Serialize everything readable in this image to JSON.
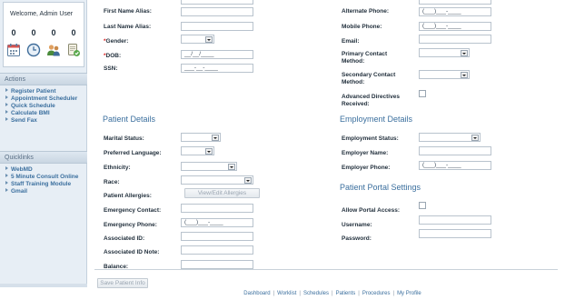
{
  "sidebar": {
    "welcome": "Welcome, Admin User",
    "counts": [
      "0",
      "0",
      "0",
      "0"
    ],
    "icons": [
      "calendar-icon",
      "clock-icon",
      "users-icon",
      "task-check-icon"
    ],
    "actions_title": "Actions",
    "actions": [
      "Register Patient",
      "Appointment Scheduler",
      "Quick Schedule",
      "Calculate BMI",
      "Send Fax"
    ],
    "quicklinks_title": "Quicklinks",
    "quicklinks": [
      "WebMD",
      "5 Minute Consult Online",
      "Staff Training Module",
      "Gmail"
    ]
  },
  "form_top_left": {
    "first_name_alias": "First Name Alias:",
    "last_name_alias": "Last Name Alias:",
    "gender": "Gender:",
    "dob": "DOB:",
    "dob_value": "__/__/____",
    "ssn": "SSN:",
    "ssn_value": "___-__-____",
    "required_mark": "*"
  },
  "form_top_right": {
    "alternate_phone": "Alternate Phone:",
    "alternate_phone_value": "(___)___-____",
    "mobile_phone": "Mobile Phone:",
    "mobile_phone_value": "(___)___-____",
    "email": "Email:",
    "primary_contact_1": "Primary Contact",
    "primary_contact_2": "Method:",
    "secondary_contact_1": "Secondary Contact",
    "secondary_contact_2": "Method:",
    "advanced_directives_1": "Advanced Directives",
    "advanced_directives_2": "Received:"
  },
  "patient_details": {
    "title": "Patient Details",
    "marital_status": "Marital Status:",
    "preferred_language": "Preferred Language:",
    "ethnicity": "Ethnicity:",
    "race": "Race:",
    "patient_allergies": "Patient Allergies:",
    "view_edit_allergies": "View/Edit Allergies",
    "emergency_contact": "Emergency Contact:",
    "emergency_phone": "Emergency Phone:",
    "emergency_phone_value": "(___)___-____",
    "associated_id": "Associated ID:",
    "associated_id_note": "Associated ID Note:",
    "balance": "Balance:"
  },
  "employment_details": {
    "title": "Employment Details",
    "employment_status": "Employment Status:",
    "employer_name": "Employer Name:",
    "employer_phone": "Employer Phone:",
    "employer_phone_value": "(___)___-____"
  },
  "patient_portal": {
    "title": "Patient Portal Settings",
    "allow_portal_access": "Allow Portal Access:",
    "username": "Username:",
    "password": "Password:"
  },
  "save_button": "Save Patient Info",
  "footer": {
    "links": [
      "Dashboard",
      "Worklist",
      "Schedules",
      "Patients",
      "Procedures",
      "My Profile"
    ],
    "separator": "|"
  }
}
